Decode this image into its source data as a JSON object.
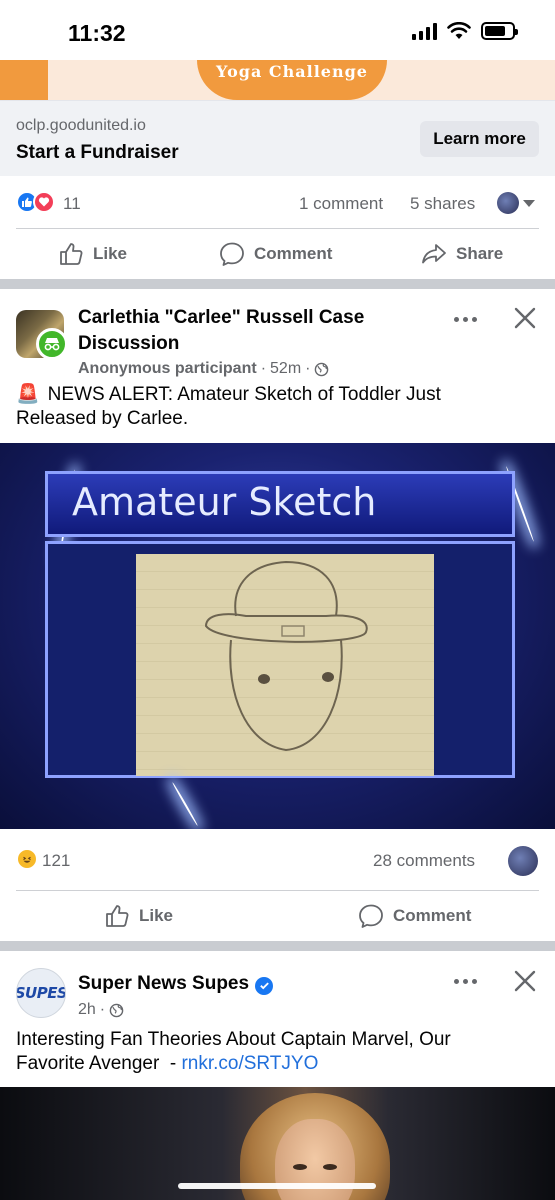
{
  "status_bar": {
    "time": "11:32"
  },
  "ad": {
    "banner_text": "Yoga Challenge",
    "domain": "oclp.goodunited.io",
    "title": "Start a Fundraiser",
    "cta_label": "Learn more"
  },
  "post1_engagement": {
    "reaction_count": "11",
    "comments": "1 comment",
    "shares": "5 shares",
    "like_label": "Like",
    "comment_label": "Comment",
    "share_label": "Share"
  },
  "post2": {
    "group_name_line1": "Carlethia \"Carlee\" Russell Case",
    "group_name_line2": "Discussion",
    "author": "Anonymous participant",
    "time": "52m",
    "alert_emoji": "🚨",
    "text_line1": "NEWS ALERT: Amateur Sketch of Toddler Just",
    "text_line2": "Released by Carlee.",
    "image_caption": "Amateur Sketch",
    "reaction_count": "121",
    "comments": "28 comments",
    "like_label": "Like",
    "comment_label": "Comment"
  },
  "post3": {
    "page_name": "Super News Supes",
    "avatar_text": "SUPES",
    "time": "2h",
    "text_line1": "Interesting Fan Theories About Captain Marvel, Our",
    "text_line2_prefix": "Favorite Avenger  - ",
    "link": "rnkr.co/SRTJYO"
  },
  "colors": {
    "facebook_blue": "#1877f2",
    "link_blue": "#216fdb",
    "meta_gray": "#65676b",
    "ad_orange": "#f19a3e"
  },
  "icons": {
    "like": "thumbs-up-outline",
    "comment": "speech-bubble-outline",
    "share": "arrow-share-outline",
    "globe": "globe",
    "more": "three-dots",
    "close": "x"
  }
}
